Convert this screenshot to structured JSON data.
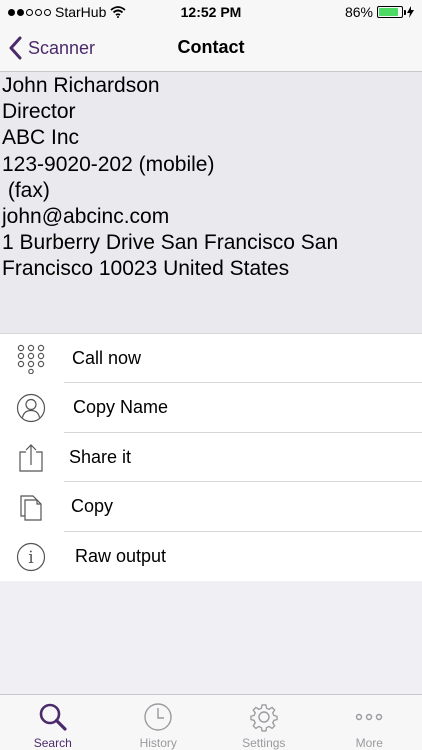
{
  "status_bar": {
    "carrier": "StarHub",
    "time": "12:52 PM",
    "battery_percent": "86%",
    "battery_level": 0.86,
    "signal_bars": 2
  },
  "nav": {
    "back_label": "Scanner",
    "title": "Contact"
  },
  "contact": {
    "lines": [
      "John Richardson",
      "Director",
      "ABC Inc",
      "123-9020-202 (mobile)",
      " (fax)",
      "john@abcinc.com",
      "1 Burberry Drive San Francisco San",
      "Francisco 10023 United States"
    ]
  },
  "actions": [
    {
      "label": "Call now",
      "icon": "keypad-icon"
    },
    {
      "label": "Copy Name",
      "icon": "person-icon"
    },
    {
      "label": "Share it",
      "icon": "share-icon"
    },
    {
      "label": "Copy",
      "icon": "copy-icon"
    },
    {
      "label": "Raw output",
      "icon": "info-icon"
    }
  ],
  "tabs": [
    {
      "label": "Search",
      "icon": "search-icon",
      "active": true
    },
    {
      "label": "History",
      "icon": "clock-icon",
      "active": false
    },
    {
      "label": "Settings",
      "icon": "gear-icon",
      "active": false
    },
    {
      "label": "More",
      "icon": "more-icon",
      "active": false
    }
  ],
  "colors": {
    "accent": "#4b2a6b",
    "inactive_tab": "#9a9a9f",
    "battery": "#4cd964",
    "contact_background": "#e9e9ee",
    "page_background": "#efeff4"
  }
}
